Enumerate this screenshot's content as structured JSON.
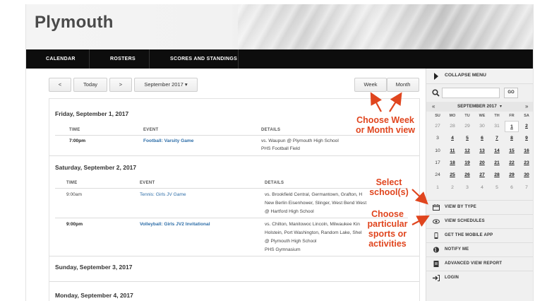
{
  "header": {
    "title": "Plymouth"
  },
  "nav": {
    "items": [
      "CALENDAR",
      "ROSTERS",
      "SCORES AND STANDINGS"
    ]
  },
  "toolbar": {
    "prev": "<",
    "today": "Today",
    "next": ">",
    "month_select": "September 2017",
    "week": "Week",
    "month": "Month"
  },
  "columns": {
    "time": "TIME",
    "event": "EVENT",
    "details": "DETAILS"
  },
  "days": [
    {
      "label": "Friday, September 1, 2017",
      "events": [
        {
          "time": "7:00pm",
          "event": "Football: Varsity Game",
          "details": [
            "vs. Waupun @ Plymouth High School",
            "PHS Football Field"
          ]
        }
      ]
    },
    {
      "label": "Saturday, September 2, 2017",
      "events": [
        {
          "time": "9:00am",
          "event": "Tennis: Girls JV Game",
          "details": [
            "vs. Brookfield Central, Germantown, Grafton, H",
            "New Berlin Eisenhower, Slinger, West Bend West",
            "@ Hartford High School"
          ]
        },
        {
          "time": "9:00pm",
          "event": "Volleyball: Girls JV2 Invitational",
          "details": [
            "vs. Chilton, Manitowoc Lincoln, Milwaukee Kin",
            "Holstein, Port Washington, Random Lake, Shel",
            "@ Plymouth High School",
            "PHS Gymnasium"
          ]
        }
      ]
    },
    {
      "label": "Sunday, September 3, 2017",
      "events": []
    },
    {
      "label": "Monday, September 4, 2017",
      "events": []
    }
  ],
  "sidebar": {
    "collapse": "COLLAPSE MENU",
    "go": "GO",
    "prev_arrow": "«",
    "next_arrow": "»",
    "calendar_month": "SEPTEMBER 2017",
    "dow": [
      "SU",
      "MO",
      "TU",
      "WE",
      "TH",
      "FR",
      "SA"
    ],
    "weeks": [
      [
        "27",
        "28",
        "29",
        "30",
        "31",
        "1",
        "2"
      ],
      [
        "3",
        "4",
        "5",
        "6",
        "7",
        "8",
        "9"
      ],
      [
        "10",
        "11",
        "12",
        "13",
        "14",
        "15",
        "16"
      ],
      [
        "17",
        "18",
        "19",
        "20",
        "21",
        "22",
        "23"
      ],
      [
        "24",
        "25",
        "26",
        "27",
        "28",
        "29",
        "30"
      ],
      [
        "1",
        "2",
        "3",
        "4",
        "5",
        "6",
        "7"
      ]
    ],
    "menu": [
      "VIEW BY TYPE",
      "VIEW SCHEDULES",
      "GET THE MOBILE APP",
      "NOTIFY ME",
      "ADVANCED VIEW REPORT",
      "LOGIN"
    ]
  },
  "annotations": {
    "week_month": [
      "Choose Week",
      "or Month view"
    ],
    "school": [
      "Select",
      "school(s)"
    ],
    "sports": [
      "Choose",
      "particular",
      "sports or",
      "activities"
    ]
  },
  "colors": {
    "annotation": "#e0451e",
    "link": "#2e6ea8",
    "nav_bg": "#0d0d0d"
  }
}
